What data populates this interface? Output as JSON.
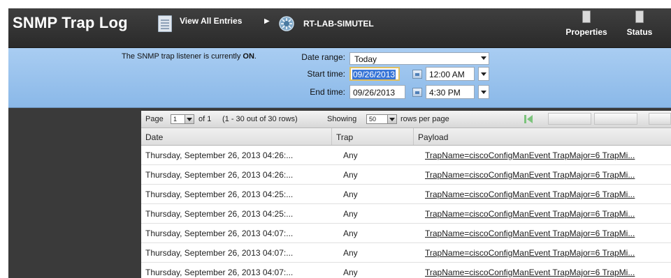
{
  "header": {
    "title": "SNMP Trap Log",
    "view_all": "View All Entries",
    "device": "RT-LAB-SIMUTEL",
    "properties": "Properties",
    "status": "Status"
  },
  "filter": {
    "listener_prefix": "The SNMP trap listener is currently",
    "listener_state": "ON",
    "listener_suffix": ".",
    "date_range_label": "Date range:",
    "date_range_value": "Today",
    "start_label": "Start time:",
    "start_date": "09/26/2013",
    "start_time": "12:00 AM",
    "end_label": "End time:",
    "end_date": "09/26/2013",
    "end_time": "4:30 PM"
  },
  "pager": {
    "page_label": "Page",
    "page_value": "1",
    "of_text": "of 1",
    "range_text": "(1 - 30 out of 30 rows)",
    "showing_label": "Showing",
    "per_page_value": "50",
    "per_page_suffix": "rows per page"
  },
  "columns": [
    "Date",
    "Trap",
    "Payload"
  ],
  "rows": [
    {
      "date": "Thursday, September 26, 2013 04:26:...",
      "trap": "Any",
      "payload": "TrapName=ciscoConfigManEvent TrapMajor=6 TrapMi..."
    },
    {
      "date": "Thursday, September 26, 2013 04:26:...",
      "trap": "Any",
      "payload": "TrapName=ciscoConfigManEvent TrapMajor=6 TrapMi..."
    },
    {
      "date": "Thursday, September 26, 2013 04:25:...",
      "trap": "Any",
      "payload": "TrapName=ciscoConfigManEvent TrapMajor=6 TrapMi..."
    },
    {
      "date": "Thursday, September 26, 2013 04:25:...",
      "trap": "Any",
      "payload": "TrapName=ciscoConfigManEvent TrapMajor=6 TrapMi..."
    },
    {
      "date": "Thursday, September 26, 2013 04:07:...",
      "trap": "Any",
      "payload": "TrapName=ciscoConfigManEvent TrapMajor=6 TrapMi..."
    },
    {
      "date": "Thursday, September 26, 2013 04:07:...",
      "trap": "Any",
      "payload": "TrapName=ciscoConfigManEvent TrapMajor=6 TrapMi..."
    },
    {
      "date": "Thursday, September 26, 2013 04:07:...",
      "trap": "Any",
      "payload": "TrapName=ciscoConfigManEvent TrapMajor=6 TrapMi..."
    }
  ],
  "icons": {
    "view_all": "document-icon",
    "breadcrumb": "chevron-right-icon",
    "device": "router-icon",
    "properties": "properties-icon",
    "status": "status-icon",
    "calendar": "calendar-icon",
    "first_page": "first-page-icon"
  },
  "colors": {
    "header_bg": "#2f2f2f",
    "filter_bg": "#9fc5ee",
    "sidebar_bg": "#3a3a3a",
    "selection": "#3875d7"
  }
}
